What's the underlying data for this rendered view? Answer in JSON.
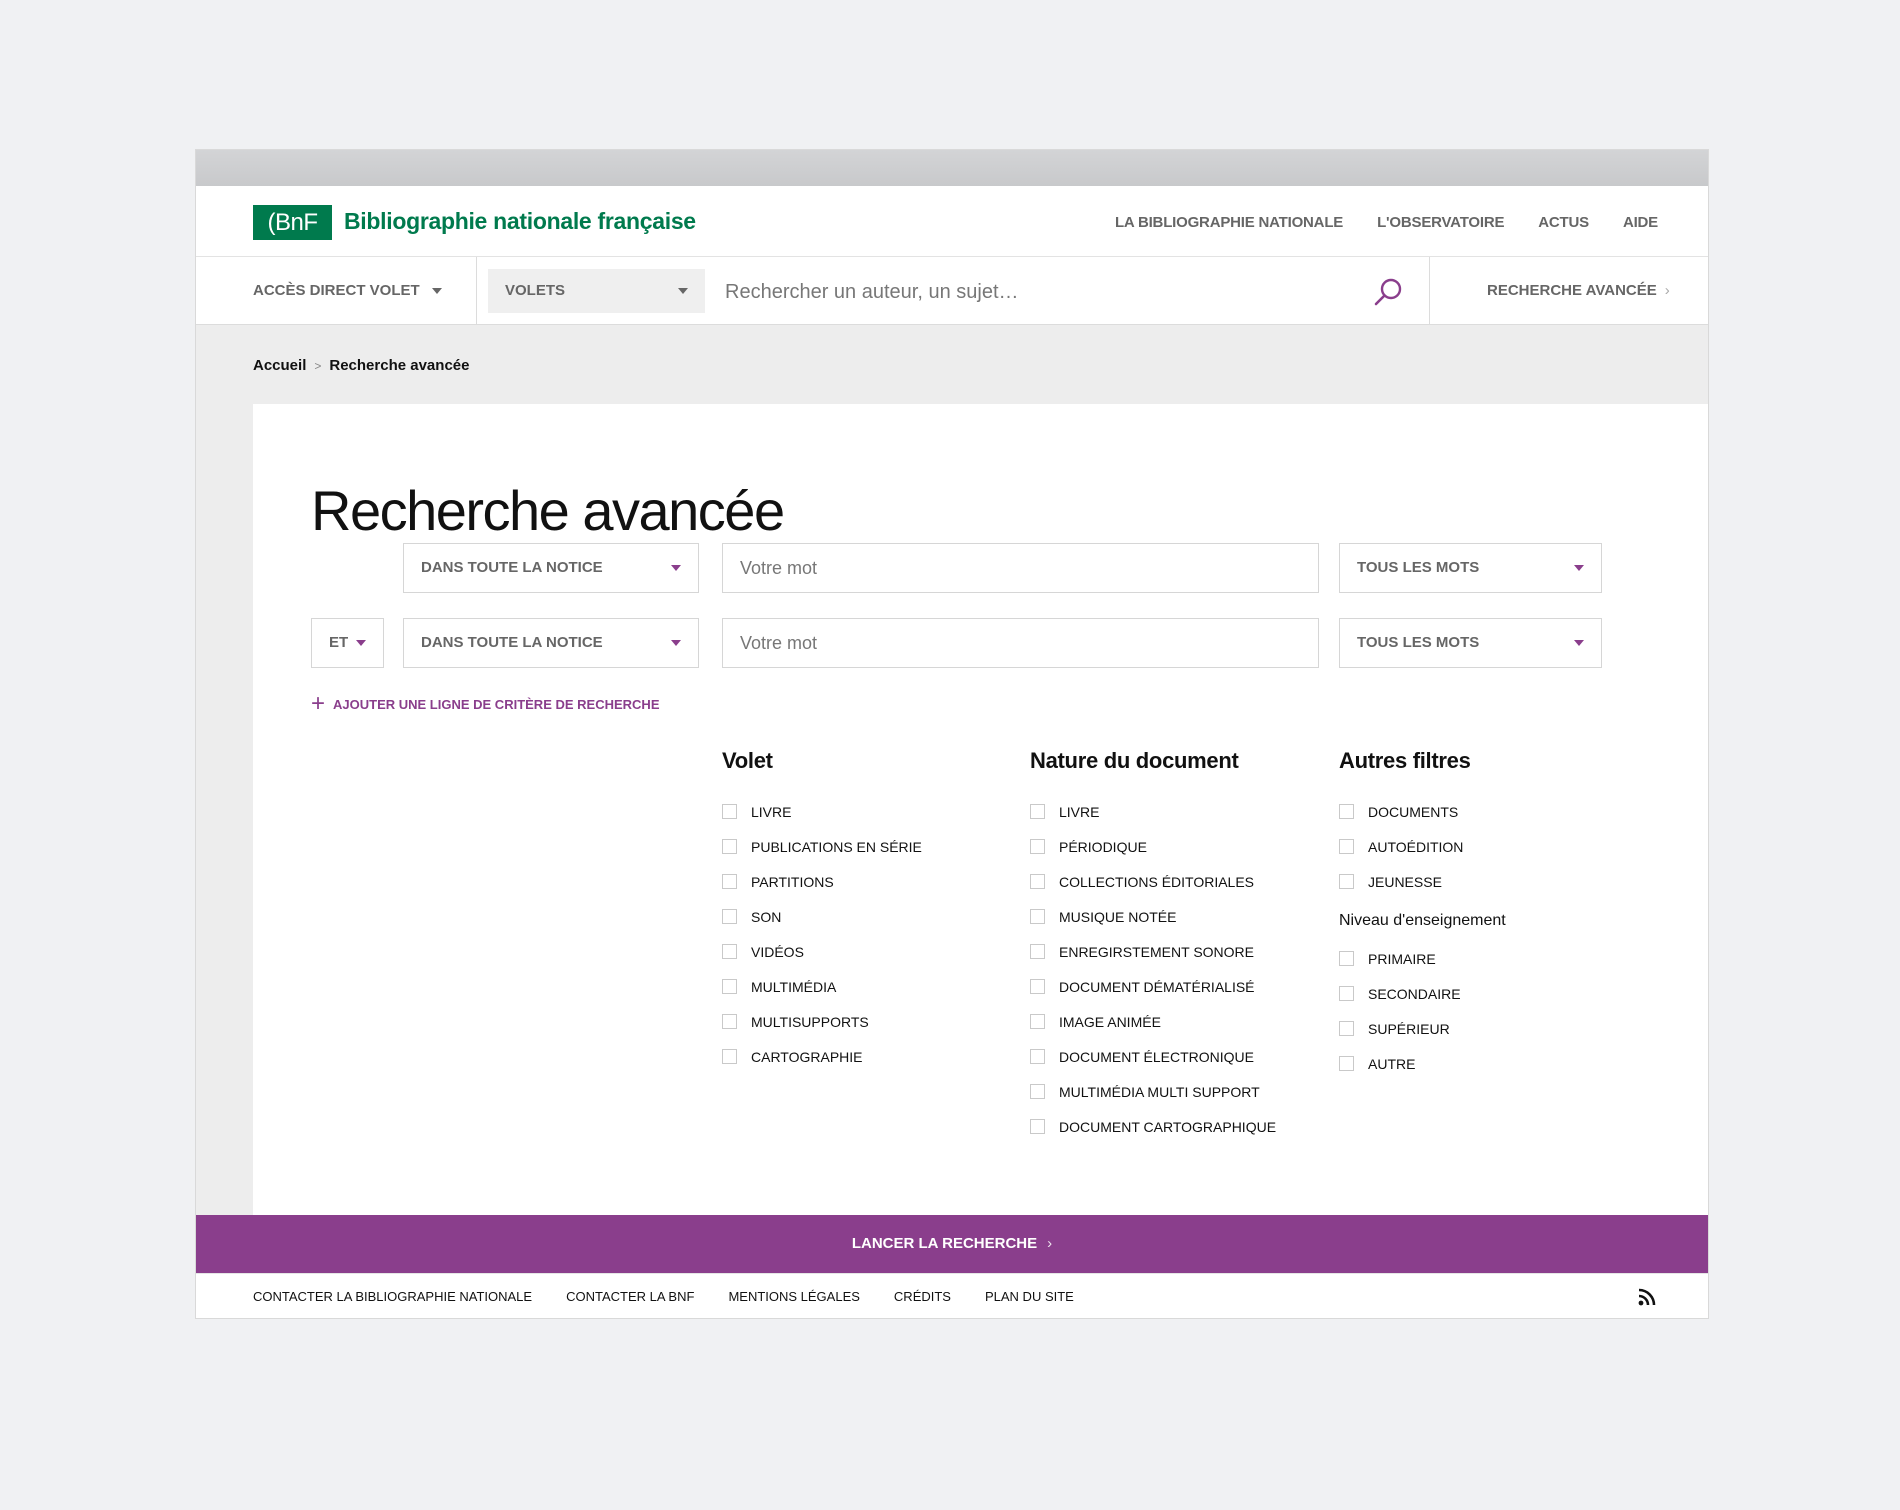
{
  "header": {
    "logo_text": "(BnF",
    "site_title": "Bibliographie nationale française",
    "nav": [
      "LA BIBLIOGRAPHIE NATIONALE",
      "L'OBSERVATOIRE",
      "ACTUS",
      "AIDE"
    ]
  },
  "searchbar": {
    "direct_access": "ACCÈS DIRECT VOLET",
    "volets": "VOLETS",
    "placeholder": "Rechercher un auteur, un sujet…",
    "advanced": "RECHERCHE AVANCÉE"
  },
  "breadcrumb": {
    "home": "Accueil",
    "separator": ">",
    "current": "Recherche avancée"
  },
  "page_title": "Recherche avancée",
  "criteria": {
    "rows": [
      {
        "operator": null,
        "field": "DANS TOUTE LA NOTICE",
        "placeholder": "Votre mot",
        "mode": "TOUS LES MOTS"
      },
      {
        "operator": "ET",
        "field": "DANS TOUTE LA NOTICE",
        "placeholder": "Votre mot",
        "mode": "TOUS LES MOTS"
      }
    ],
    "add_line": "AJOUTER UNE LIGNE DE CRITÈRE DE RECHERCHE"
  },
  "filters": {
    "volet": {
      "title": "Volet",
      "items": [
        "LIVRE",
        "PUBLICATIONS EN SÉRIE",
        "PARTITIONS",
        "SON",
        "VIDÉOS",
        "MULTIMÉDIA",
        "MULTISUPPORTS",
        "CARTOGRAPHIE"
      ]
    },
    "nature": {
      "title": "Nature du document",
      "items": [
        "LIVRE",
        "PÉRIODIQUE",
        "COLLECTIONS ÉDITORIALES",
        "MUSIQUE NOTÉE",
        "ENREGIRSTEMENT SONORE",
        "DOCUMENT DÉMATÉRIALISÉ",
        "IMAGE ANIMÉE",
        "DOCUMENT ÉLECTRONIQUE",
        "MULTIMÉDIA MULTI SUPPORT",
        "DOCUMENT CARTOGRAPHIQUE"
      ]
    },
    "autres": {
      "title": "Autres filtres",
      "items": [
        "DOCUMENTS",
        "AUTOÉDITION",
        "JEUNESSE"
      ],
      "subtitle": "Niveau d'enseignement",
      "levels": [
        "PRIMAIRE",
        "SECONDAIRE",
        "SUPÉRIEUR",
        "AUTRE"
      ]
    }
  },
  "launch_button": "LANCER LA RECHERCHE",
  "footer": {
    "links": [
      "CONTACTER LA BIBLIOGRAPHIE NATIONALE",
      "CONTACTER LA BNF",
      "MENTIONS LÉGALES",
      "CRÉDITS",
      "PLAN DU SITE"
    ],
    "rss_icon": "rss-icon"
  },
  "colors": {
    "brand_green": "#007a4d",
    "accent_purple": "#8a3e8c"
  }
}
